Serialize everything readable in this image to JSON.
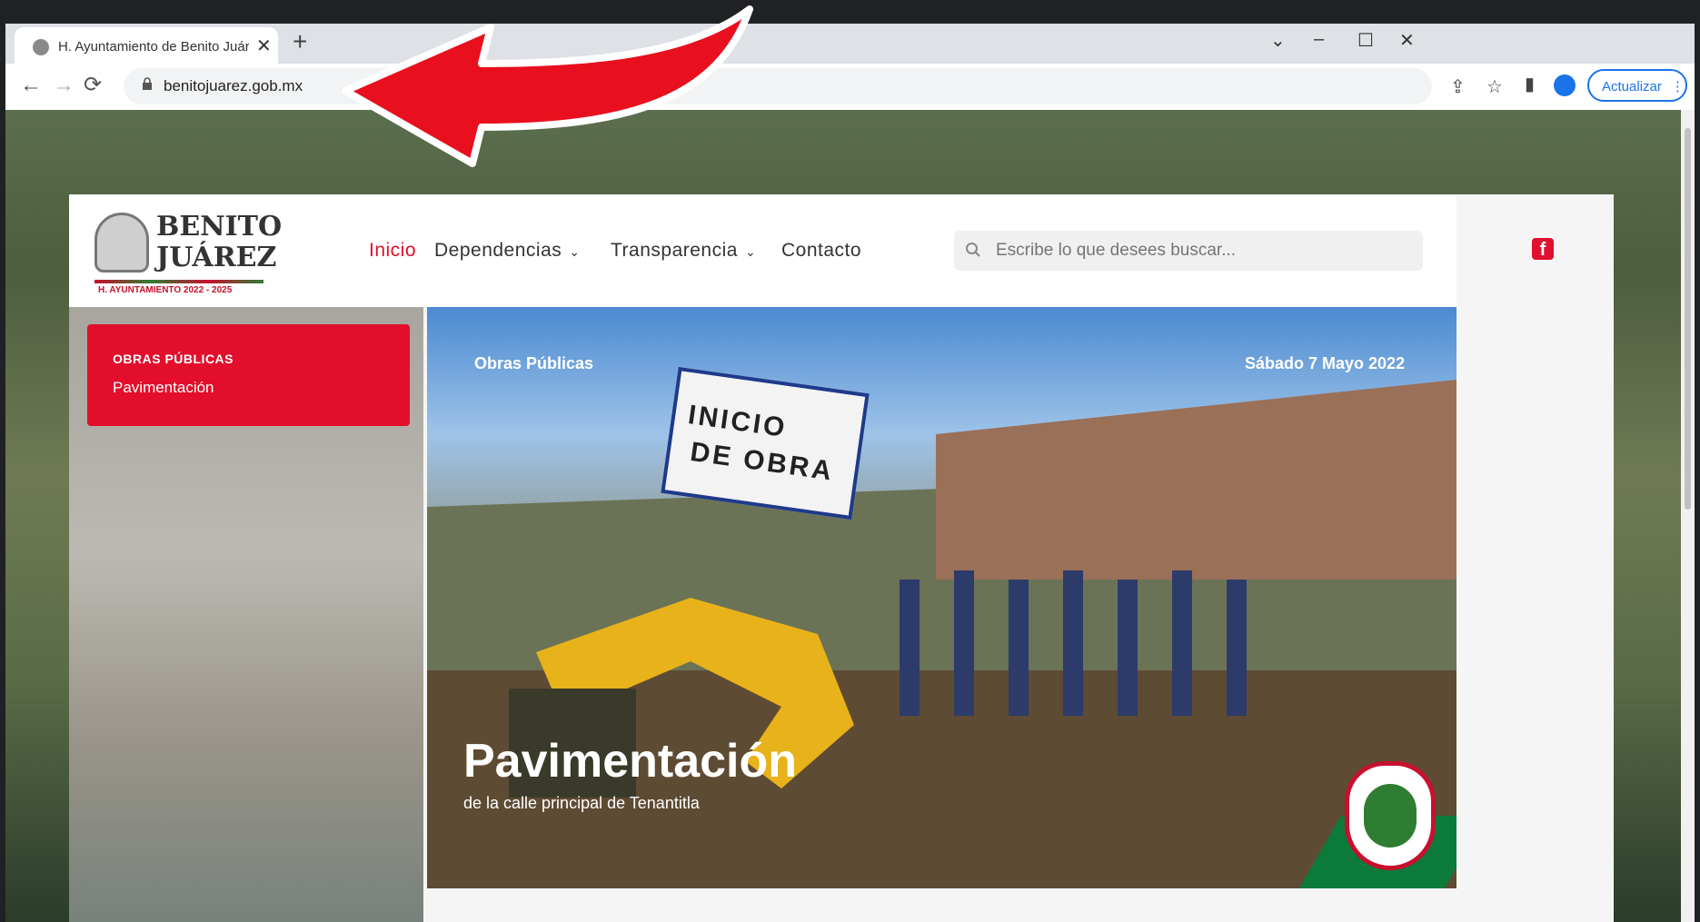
{
  "browser": {
    "tab_title": "H. Ayuntamiento de Benito Juárez",
    "new_tab_symbol": "+",
    "close_symbol": "✕",
    "url": "benitojuarez.gob.mx",
    "update_label": "Actualizar",
    "window_controls": [
      "⌄",
      "–",
      "☐",
      "✕"
    ],
    "nav_icons": [
      "←",
      "→",
      "⟳"
    ],
    "toolbar_icons": [
      "share-icon",
      "star-icon",
      "sidepanel-icon",
      "profile-icon"
    ]
  },
  "site": {
    "logo": {
      "line1": "BENITO",
      "line2": "JUÁREZ",
      "sub": "H. AYUNTAMIENTO 2022 - 2025"
    },
    "nav": [
      {
        "label": "Inicio",
        "active": true
      },
      {
        "label": "Dependencias",
        "dropdown": true
      },
      {
        "label": "Transparencia",
        "dropdown": true
      },
      {
        "label": "Contacto"
      }
    ],
    "search_placeholder": "Escribe lo que desees buscar...",
    "social": "facebook-icon",
    "accent_color": "#e20e2b"
  },
  "sidebar_card": {
    "category": "OBRAS PÚBLICAS",
    "title": "Pavimentación"
  },
  "hero": {
    "category": "Obras Públicas",
    "date": "Sábado 7 Mayo 2022",
    "title": "Pavimentación",
    "subtitle": "de la calle principal de Tenantitla",
    "sign_line1": "INICIO",
    "sign_line2": "DE OBRA"
  },
  "annotation": {
    "arrow_color": "#e8101e"
  }
}
